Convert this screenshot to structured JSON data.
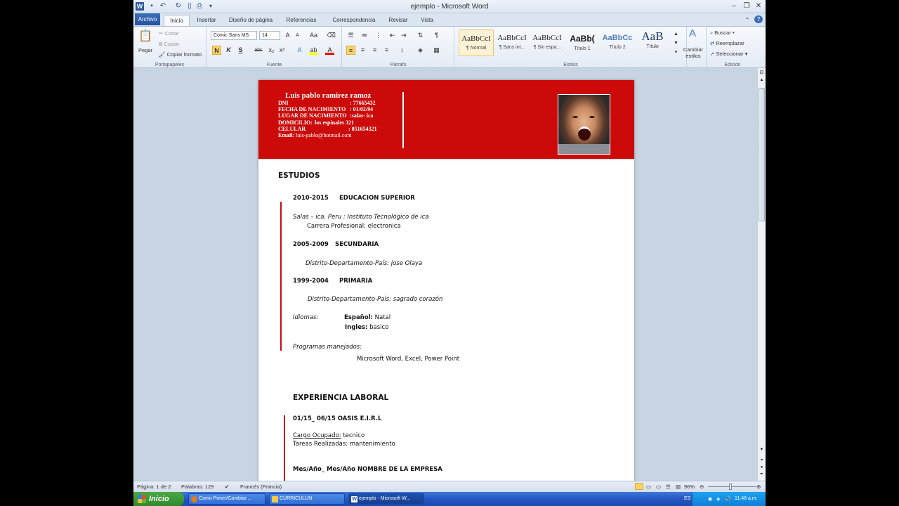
{
  "window": {
    "title": "ejemplo  -  Microsoft Word",
    "logo": "W"
  },
  "quick_access": {
    "icons": [
      "save-icon",
      "undo-icon",
      "redo-icon",
      "new-doc-icon",
      "print-preview-icon",
      "customize-icon"
    ]
  },
  "tabs": {
    "file": "Archivo",
    "items": [
      "Inicio",
      "Insertar",
      "Diseño de página",
      "Referencias",
      "Correspondencia",
      "Revisar",
      "Vista"
    ]
  },
  "ribbon": {
    "clipboard": {
      "paste": "Pegar",
      "cut": "Cortar",
      "copy": "Copiar",
      "format_painter": "Copiar formato",
      "label": "Portapapeles"
    },
    "font": {
      "font_name": "Comic Sans MS",
      "font_size": "14",
      "bold": "N",
      "italic": "K",
      "underline": "S",
      "strike": "abc",
      "sub": "x₂",
      "sup": "x²",
      "label": "Fuente"
    },
    "paragraph": {
      "label": "Párrafo"
    },
    "styles": {
      "items": [
        {
          "preview": "AaBbCcI",
          "name": "¶ Normal"
        },
        {
          "preview": "AaBbCcI",
          "name": "¶ Sans int..."
        },
        {
          "preview": "AaBbCcI",
          "name": "¶ Sin espa..."
        },
        {
          "preview": "AaBb(",
          "name": "Título 1"
        },
        {
          "preview": "AaBbCc",
          "name": "Título 2"
        },
        {
          "preview": "AaB",
          "name": "Título"
        }
      ],
      "change": "Cambiar estilos",
      "label": "Estilos"
    },
    "editing": {
      "find": "Buscar",
      "replace": "Reemplazar",
      "select": "Seleccionar",
      "label": "Edición"
    }
  },
  "cv": {
    "name": "Luis pablo ramirez ramoz",
    "info": [
      {
        "label": "DNI",
        "value": ": 77665432"
      },
      {
        "label": "FECHA DE NACIMIENTO",
        "value": ": 01/02/94"
      },
      {
        "label": "LUGAR DE NACIMIENTO",
        "value": ":salas- ica"
      },
      {
        "label": "DOMICILIO:",
        "value": "los espinales 321"
      },
      {
        "label": "CELULAR",
        "value": ":      051654321"
      },
      {
        "label": "Email:",
        "value": "luis-pablo@hotmail.com"
      }
    ],
    "studies_title": "ESTUDIOS",
    "sup_years": "2010-2015",
    "sup_title": "EDUCACION SUPERIOR",
    "sup_place": "Salas – ica. Peru : Instituto  Tecnológico de ica",
    "sup_career_label": "Carrera  Profesional:",
    "sup_career": "electronica",
    "sec_years": "2005-2009",
    "sec_title": "SECUNDARIA",
    "sec_place": "Distrito-Departamento-País:  jose Olaya",
    "pri_years": "1999-2004",
    "pri_title": "PRIMARIA",
    "pri_place": "Distrito-Departamento-País: sagrado corazón",
    "languages_label": "Idiomas:",
    "lang1_label": "Español:",
    "lang1_value": "Natal",
    "lang2_label": "Ingles:",
    "lang2_value": "basico",
    "programs_label": "Programas manejados:",
    "programs": "Microsoft  Word, Excel,  Power Point",
    "exp_title": "EXPERIENCIA LABORAL",
    "exp1": "01/15_ 06/15 OASIS E.I.R.L",
    "cargo_label": "Cargo Ocupado:",
    "cargo": "tecnico",
    "tareas_label": "Tareas Realizadas:",
    "tareas": "mantenimiento",
    "exp2": "Mes/Año_ Mes/Año  NOMBRE DE LA EMPRESA"
  },
  "status": {
    "page": "Página: 1 de 2",
    "words": "Palabras: 129",
    "language": "Francés (Francia)",
    "zoom": "96%"
  },
  "taskbar": {
    "start": "Inicio",
    "tasks": [
      "Como Poner/Cambiar ...",
      "CURRICULUN",
      "ejemplo - Microsoft W..."
    ],
    "lang": "ES",
    "time": "11:48 a.m."
  }
}
